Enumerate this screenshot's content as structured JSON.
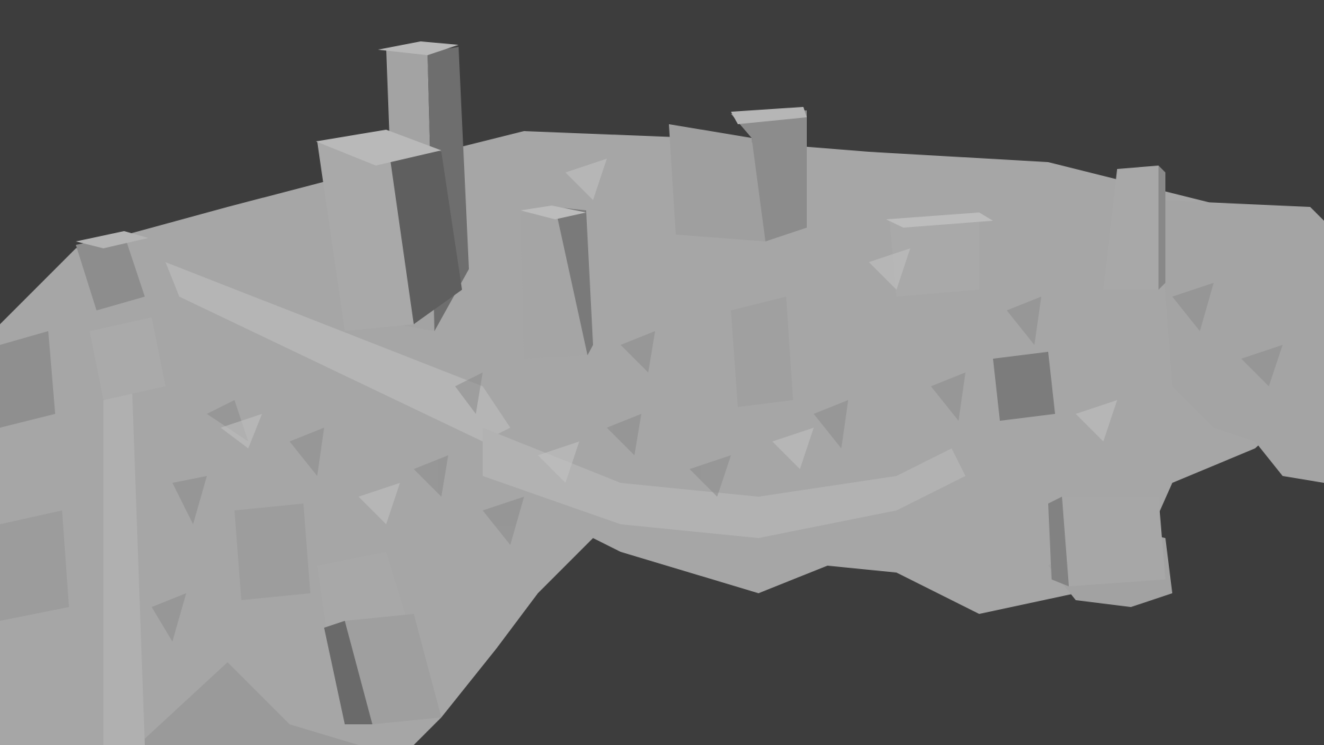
{
  "viewport": {
    "background_color": "#3d3d3d",
    "shading": "solid-gray",
    "subject": "city-mesh"
  },
  "colors": {
    "ground_light": "#a9a9a9",
    "ground_mid": "#9b9b9b",
    "face_lit": "#b4b4b4",
    "face_mid": "#9e9e9e",
    "face_shade": "#7d7d7d",
    "face_dark": "#636363",
    "roof": "#bdbdbd",
    "edge": "#5a5a5a"
  }
}
